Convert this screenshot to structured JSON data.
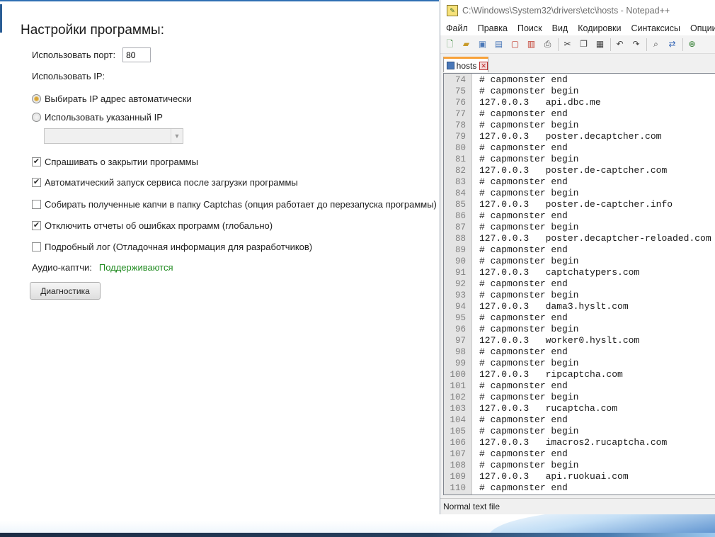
{
  "settings": {
    "title": "Настройки программы:",
    "port_label": "Использовать порт:",
    "port_value": "80",
    "ip_label": "Использовать IP:",
    "radio_auto_label": "Выбирать IP адрес автоматически",
    "radio_auto_checked": true,
    "radio_manual_label": "Использовать указанный IP",
    "radio_manual_checked": false,
    "ip_select_value": "",
    "checkboxes": [
      {
        "label": "Спрашивать о закрытии программы",
        "checked": true
      },
      {
        "label": "Автоматический запуск сервиса после загрузки программы",
        "checked": true
      },
      {
        "label": "Собирать полученные капчи в папку Captchas (опция работает до перезапуска программы)",
        "checked": false
      },
      {
        "label": "Отключить отчеты об ошибках программ (глобально)",
        "checked": true
      },
      {
        "label": "Подробный лог (Отладочная информация для разработчиков)",
        "checked": false
      }
    ],
    "audio_label": "Аудио-каптчи:",
    "audio_status": "Поддерживаются",
    "audio_status_color": "#1f8a1f",
    "diag_button": "Диагностика"
  },
  "notepad": {
    "title": "C:\\Windows\\System32\\drivers\\etc\\hosts - Notepad++",
    "menu": [
      "Файл",
      "Правка",
      "Поиск",
      "Вид",
      "Кодировки",
      "Синтаксисы",
      "Опции"
    ],
    "toolbar_icons": [
      "new-file-icon",
      "open-file-icon",
      "save-icon",
      "save-all-icon",
      "close-icon",
      "close-all-icon",
      "print-icon",
      "cut-icon",
      "copy-icon",
      "paste-icon",
      "undo-icon",
      "redo-icon",
      "find-icon",
      "replace-icon",
      "zoom-in-icon"
    ],
    "tab_label": "hosts",
    "tab_accent": "#f8a23a",
    "lines": [
      {
        "n": "74",
        "t": "# capmonster end"
      },
      {
        "n": "75",
        "t": "# capmonster begin"
      },
      {
        "n": "76",
        "t": "127.0.0.3   api.dbc.me"
      },
      {
        "n": "77",
        "t": "# capmonster end"
      },
      {
        "n": "78",
        "t": "# capmonster begin"
      },
      {
        "n": "79",
        "t": "127.0.0.3   poster.decaptcher.com"
      },
      {
        "n": "80",
        "t": "# capmonster end"
      },
      {
        "n": "81",
        "t": "# capmonster begin"
      },
      {
        "n": "82",
        "t": "127.0.0.3   poster.de-captcher.com"
      },
      {
        "n": "83",
        "t": "# capmonster end"
      },
      {
        "n": "84",
        "t": "# capmonster begin"
      },
      {
        "n": "85",
        "t": "127.0.0.3   poster.de-captcher.info"
      },
      {
        "n": "86",
        "t": "# capmonster end"
      },
      {
        "n": "87",
        "t": "# capmonster begin"
      },
      {
        "n": "88",
        "t": "127.0.0.3   poster.decaptcher-reloaded.com"
      },
      {
        "n": "89",
        "t": "# capmonster end"
      },
      {
        "n": "90",
        "t": "# capmonster begin"
      },
      {
        "n": "91",
        "t": "127.0.0.3   captchatypers.com"
      },
      {
        "n": "92",
        "t": "# capmonster end"
      },
      {
        "n": "93",
        "t": "# capmonster begin"
      },
      {
        "n": "94",
        "t": "127.0.0.3   dama3.hyslt.com"
      },
      {
        "n": "95",
        "t": "# capmonster end"
      },
      {
        "n": "96",
        "t": "# capmonster begin"
      },
      {
        "n": "97",
        "t": "127.0.0.3   worker0.hyslt.com"
      },
      {
        "n": "98",
        "t": "# capmonster end"
      },
      {
        "n": "99",
        "t": "# capmonster begin"
      },
      {
        "n": "100",
        "t": "127.0.0.3   ripcaptcha.com"
      },
      {
        "n": "101",
        "t": "# capmonster end"
      },
      {
        "n": "102",
        "t": "# capmonster begin"
      },
      {
        "n": "103",
        "t": "127.0.0.3   rucaptcha.com"
      },
      {
        "n": "104",
        "t": "# capmonster end"
      },
      {
        "n": "105",
        "t": "# capmonster begin"
      },
      {
        "n": "106",
        "t": "127.0.0.3   imacros2.rucaptcha.com"
      },
      {
        "n": "107",
        "t": "# capmonster end"
      },
      {
        "n": "108",
        "t": "# capmonster begin"
      },
      {
        "n": "109",
        "t": "127.0.0.3   api.ruokuai.com"
      },
      {
        "n": "110",
        "t": "# capmonster end"
      }
    ],
    "status_text": "Normal text file"
  }
}
